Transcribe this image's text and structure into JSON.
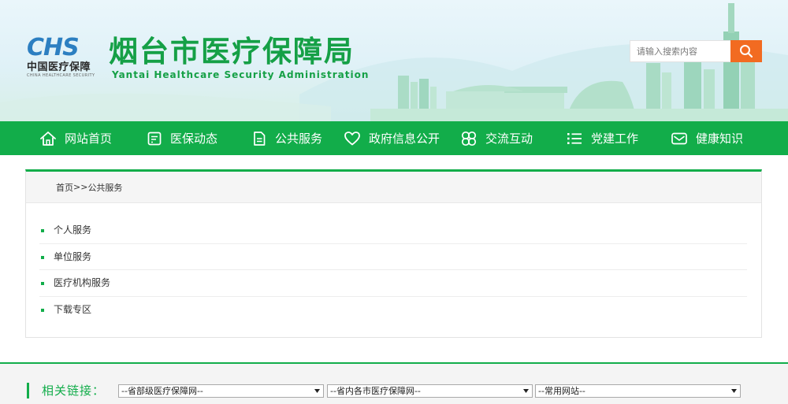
{
  "header": {
    "logo_mark": "CHS",
    "logo_cn": "中国医疗保障",
    "logo_en": "CHINA HEALTHCARE SECURITY",
    "site_title": "烟台市医疗保障局",
    "site_subtitle": "Yantai Healthcare Security Administration"
  },
  "search": {
    "placeholder": "请输入搜索内容",
    "value": "",
    "icon": "search-icon"
  },
  "nav": {
    "items": [
      {
        "label": "网站首页",
        "icon": "home-icon"
      },
      {
        "label": "医保动态",
        "icon": "news-icon"
      },
      {
        "label": "公共服务",
        "icon": "document-icon"
      },
      {
        "label": "政府信息公开",
        "icon": "heart-icon"
      },
      {
        "label": "交流互动",
        "icon": "clover-icon"
      },
      {
        "label": "党建工作",
        "icon": "list-icon"
      },
      {
        "label": "健康知识",
        "icon": "mail-icon"
      }
    ]
  },
  "breadcrumb": {
    "home": "首页",
    "separator": ">>",
    "current": "公共服务"
  },
  "services": [
    {
      "label": "个人服务"
    },
    {
      "label": "单位服务"
    },
    {
      "label": "医疗机构服务"
    },
    {
      "label": "下载专区"
    }
  ],
  "links": {
    "label": "相关链接：",
    "selects": [
      {
        "value": "--省部级医疗保障网--"
      },
      {
        "value": "--省内各市医疗保障网--"
      },
      {
        "value": "--常用网站--"
      }
    ]
  },
  "colors": {
    "primary_green": "#12ad4a",
    "title_green": "#15a046",
    "search_orange": "#f26b21",
    "logo_blue": "#2c7fc1"
  }
}
